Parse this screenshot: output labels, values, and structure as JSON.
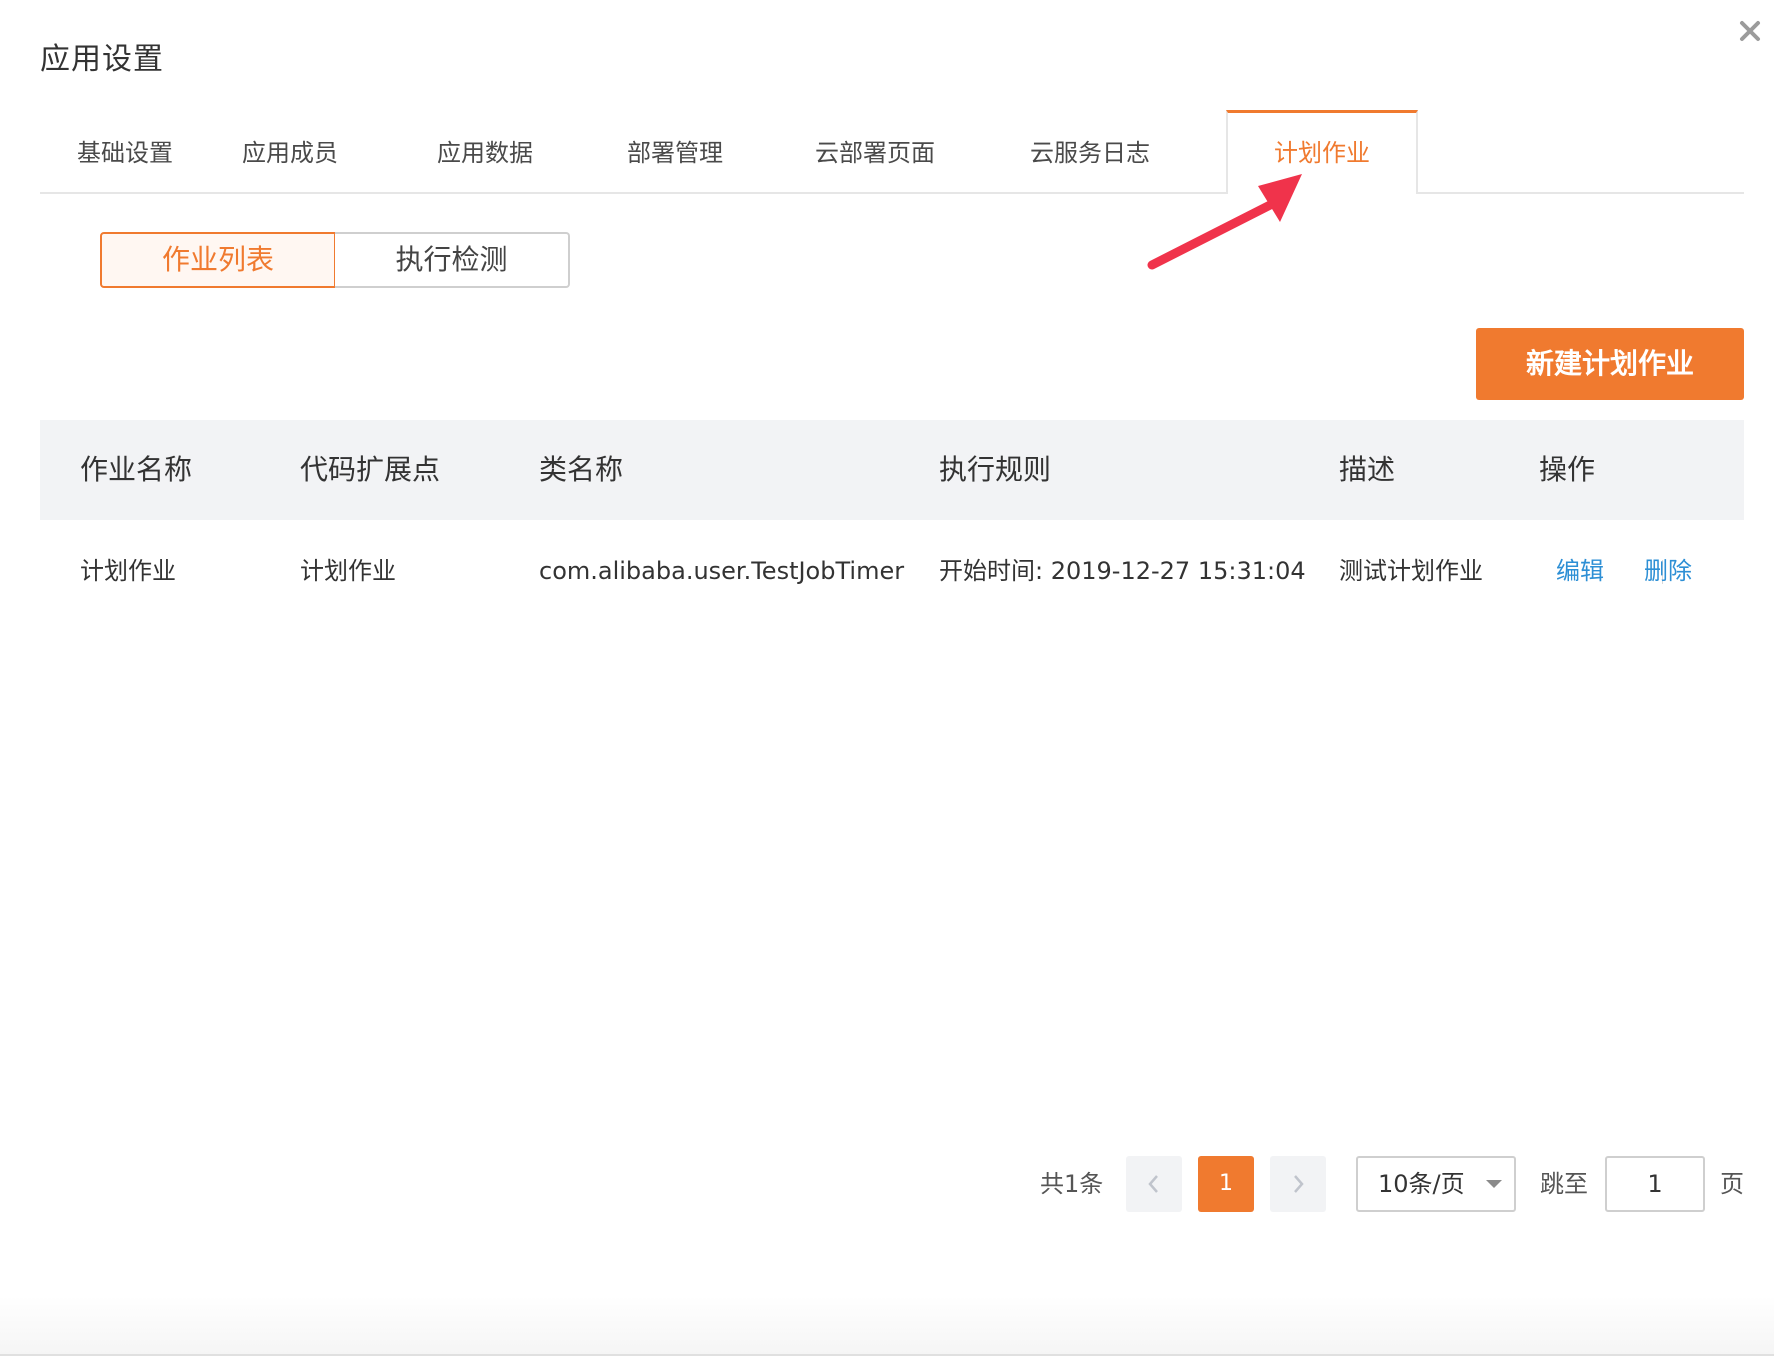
{
  "dialog": {
    "title": "应用设置",
    "close_icon": "close-icon"
  },
  "tabs": [
    {
      "label": "基础设置",
      "active": false
    },
    {
      "label": "应用成员",
      "active": false
    },
    {
      "label": "应用数据",
      "active": false
    },
    {
      "label": "部署管理",
      "active": false
    },
    {
      "label": "云部署页面",
      "active": false
    },
    {
      "label": "云服务日志",
      "active": false
    },
    {
      "label": "计划作业",
      "active": true
    }
  ],
  "segments": {
    "job_list": "作业列表",
    "exec_check": "执行检测"
  },
  "toolbar": {
    "new_job_label": "新建计划作业"
  },
  "table": {
    "columns": [
      "作业名称",
      "代码扩展点",
      "类名称",
      "执行规则",
      "描述",
      "操作"
    ],
    "rows": [
      {
        "job_name": "计划作业",
        "extension_point": "计划作业",
        "class_name": "com.alibaba.user.TestJobTimer",
        "rule": "开始时间: 2019-12-27 15:31:04",
        "description": "测试计划作业",
        "actions": {
          "edit": "编辑",
          "delete": "删除"
        }
      }
    ]
  },
  "pagination": {
    "total": "共1条",
    "current_page": "1",
    "page_size": "10条/页",
    "jump_label": "跳至",
    "jump_value": "1",
    "page_suffix": "页"
  },
  "colors": {
    "accent": "#f07a2f",
    "link": "#2d8fd5",
    "annotation_arrow": "#f0334b"
  }
}
